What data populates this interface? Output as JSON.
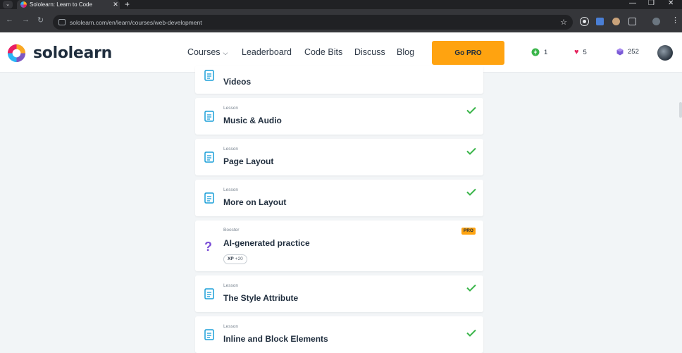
{
  "browser": {
    "tab_title": "Sololearn: Learn to Code",
    "tab_close": "✕",
    "new_tab": "+",
    "tab_menu": "⌄",
    "url": "sololearn.com/en/learn/courses/web-development",
    "window_controls": [
      "—",
      "❐",
      "✕"
    ],
    "nav": [
      "←",
      "→",
      "↻"
    ]
  },
  "header": {
    "logo_text": "sololearn",
    "nav": {
      "courses": "Courses",
      "leaderboard": "Leaderboard",
      "code_bits": "Code Bits",
      "discuss": "Discuss",
      "blog": "Blog"
    },
    "gopro": "Go PRO",
    "stats": {
      "streak": "1",
      "hearts": "5",
      "gems": "252"
    }
  },
  "lessons": [
    {
      "type": "",
      "title": "Videos",
      "done": false
    },
    {
      "type": "Lesson",
      "title": "Music & Audio",
      "done": true
    },
    {
      "type": "Lesson",
      "title": "Page Layout",
      "done": true
    },
    {
      "type": "Lesson",
      "title": "More on Layout",
      "done": true
    },
    {
      "type": "Booster",
      "title": "AI-generated practice",
      "badge": "PRO",
      "xp_label": "XP",
      "xp_value": "+20"
    },
    {
      "type": "Lesson",
      "title": "The Style Attribute",
      "done": true
    },
    {
      "type": "Lesson",
      "title": "Inline and Block Elements",
      "done": true
    }
  ],
  "colors": {
    "brand_orange": "#ffa310",
    "check_green": "#3ab54a",
    "doc_blue": "#1a9fd8",
    "heart_pink": "#e5245e",
    "gem_purple": "#7b5bd6",
    "streak_green": "#3ab54a"
  }
}
